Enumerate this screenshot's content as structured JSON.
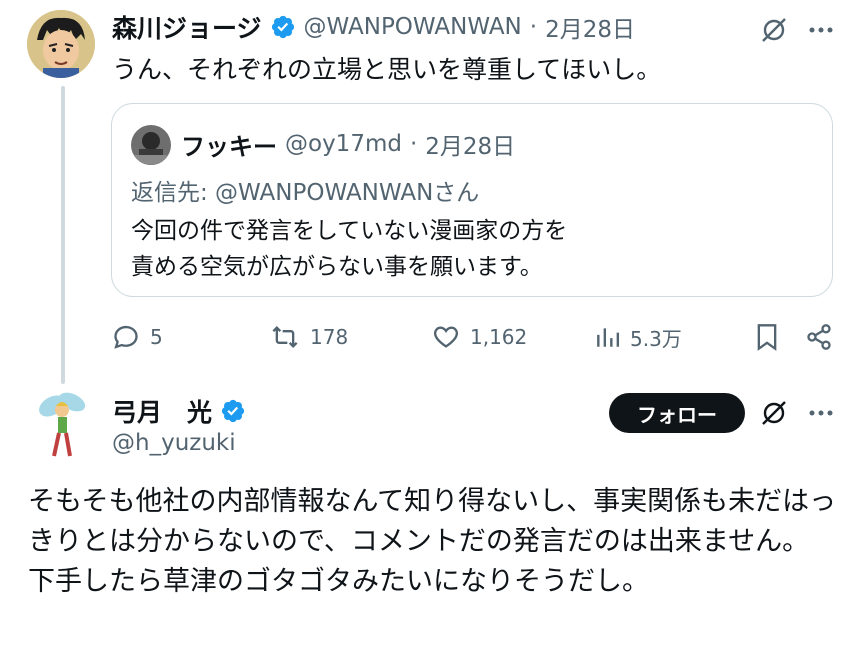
{
  "tweet1": {
    "display_name": "森川ジョージ",
    "handle": "@WANPOWANWAN",
    "separator": "·",
    "date": "2月28日",
    "text": "うん、それぞれの立場と思いを尊重してほいし。",
    "verified_color": "#1d9bf0"
  },
  "quote": {
    "display_name": "フッキー",
    "handle": "@oy17md",
    "separator": "·",
    "date": "2月28日",
    "reply_to": "返信先: @WANPOWANWANさん",
    "line1": "今回の件で発言をしていない漫画家の方を",
    "line2": "責める空気が広がらない事を願います。"
  },
  "actions": {
    "replies": "5",
    "reposts": "178",
    "likes": "1,162",
    "views": "5.3万"
  },
  "tweet2": {
    "display_name": "弓月　光",
    "handle": "@h_yuzuki",
    "follow_label": "フォロー",
    "text": "そもそも他社の内部情報なんて知り得ないし、事実関係も未だはっきりとは分からないので、コメントだの発言だのは出来ません。\n下手したら草津のゴタゴタみたいになりそうだし。"
  },
  "icons": [
    "grok-icon",
    "more-icon",
    "reply-icon",
    "repost-icon",
    "like-icon",
    "views-icon",
    "bookmark-icon",
    "share-icon",
    "verified-icon"
  ]
}
